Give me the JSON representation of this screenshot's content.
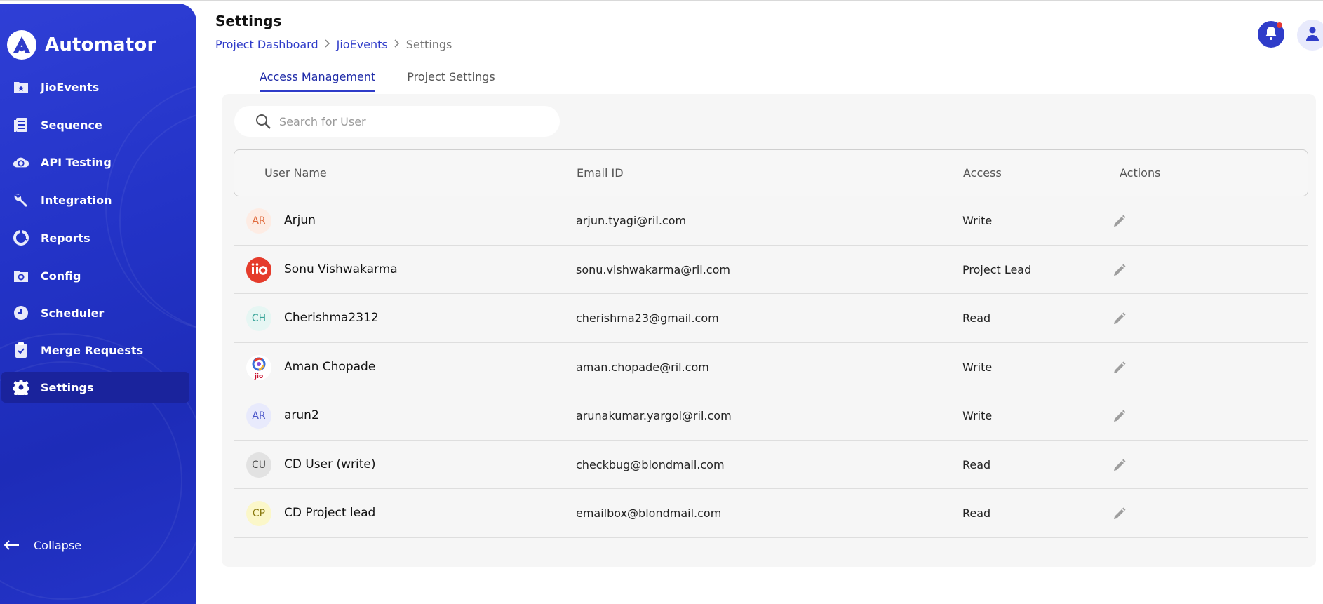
{
  "app": {
    "name": "Automator"
  },
  "sidebar": {
    "items": [
      {
        "label": "JioEvents",
        "icon": "folder-star-icon"
      },
      {
        "label": "Sequence",
        "icon": "document-list-icon"
      },
      {
        "label": "API Testing",
        "icon": "cloud-sync-icon"
      },
      {
        "label": "Integration",
        "icon": "wrench-icon"
      },
      {
        "label": "Reports",
        "icon": "pie-chart-icon"
      },
      {
        "label": "Config",
        "icon": "folder-gear-icon"
      },
      {
        "label": "Scheduler",
        "icon": "clock-icon"
      },
      {
        "label": "Merge Requests",
        "icon": "clipboard-check-icon"
      },
      {
        "label": "Settings",
        "icon": "gear-icon",
        "active": true
      }
    ],
    "collapse_label": "Collapse"
  },
  "header": {
    "title": "Settings",
    "breadcrumb": [
      "Project Dashboard",
      "JioEvents",
      "Settings"
    ]
  },
  "tabs": [
    {
      "label": "Access Management",
      "active": true
    },
    {
      "label": "Project Settings",
      "active": false
    }
  ],
  "search": {
    "placeholder": "Search for User",
    "value": ""
  },
  "table": {
    "columns": [
      "User Name",
      "Email ID",
      "Access",
      "Actions"
    ],
    "rows": [
      {
        "initials": "AR",
        "avatar_type": "initials",
        "avatar_bg": "#fdece4",
        "avatar_fg": "#e06a3c",
        "name": "Arjun",
        "email": "arjun.tyagi@ril.com",
        "access": "Write"
      },
      {
        "initials": "jio",
        "avatar_type": "jio-logo",
        "avatar_bg": "#e53c2c",
        "avatar_fg": "#ffffff",
        "name": "Sonu Vishwakarma",
        "email": "sonu.vishwakarma@ril.com",
        "access": "Project Lead"
      },
      {
        "initials": "CH",
        "avatar_type": "initials",
        "avatar_bg": "#e6f6f3",
        "avatar_fg": "#3aa59a",
        "name": "Cherishma2312",
        "email": "cherishma23@gmail.com",
        "access": "Read"
      },
      {
        "initials": "jio",
        "avatar_type": "jio-ring-logo",
        "avatar_bg": "#ffffff",
        "avatar_fg": "#c8102e",
        "name": "Aman Chopade",
        "email": "aman.chopade@ril.com",
        "access": "Write"
      },
      {
        "initials": "AR",
        "avatar_type": "initials",
        "avatar_bg": "#e8eafc",
        "avatar_fg": "#4a55c9",
        "name": "arun2",
        "email": "arunakumar.yargol@ril.com",
        "access": "Write"
      },
      {
        "initials": "CU",
        "avatar_type": "initials",
        "avatar_bg": "#e2e2e2",
        "avatar_fg": "#444444",
        "name": "CD User (write)",
        "email": "checkbug@blondmail.com",
        "access": "Read"
      },
      {
        "initials": "CP",
        "avatar_type": "initials",
        "avatar_bg": "#fbf7c9",
        "avatar_fg": "#8a7a10",
        "name": "CD Project lead",
        "email": "emailbox@blondmail.com",
        "access": "Read"
      }
    ]
  },
  "colors": {
    "accent": "#2f3cc9",
    "sidebar": "#2333c7",
    "sidebar_active": "#1a239c",
    "notification_dot": "#e53935"
  }
}
